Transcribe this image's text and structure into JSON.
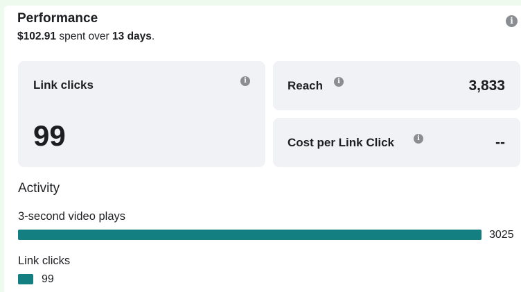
{
  "performance": {
    "title": "Performance",
    "spent": "$102.91",
    "spent_mid": " spent over ",
    "days": "13 days",
    "period_end": "."
  },
  "metrics": {
    "link_clicks": {
      "label": "Link clicks",
      "value": "99"
    },
    "reach": {
      "label": "Reach",
      "value": "3,833"
    },
    "cost_per_link_click": {
      "label": "Cost per Link Click",
      "value": "--"
    }
  },
  "activity": {
    "title": "Activity",
    "rows": [
      {
        "label": "3-second video plays",
        "value": 3025
      },
      {
        "label": "Link clicks",
        "value": 99
      }
    ]
  },
  "colors": {
    "bar": "#137f81",
    "card_bg": "#f0f2f5",
    "info_icon": "#8a8d91"
  },
  "icons": {
    "info": "info-icon",
    "info_glyph": "i"
  }
}
